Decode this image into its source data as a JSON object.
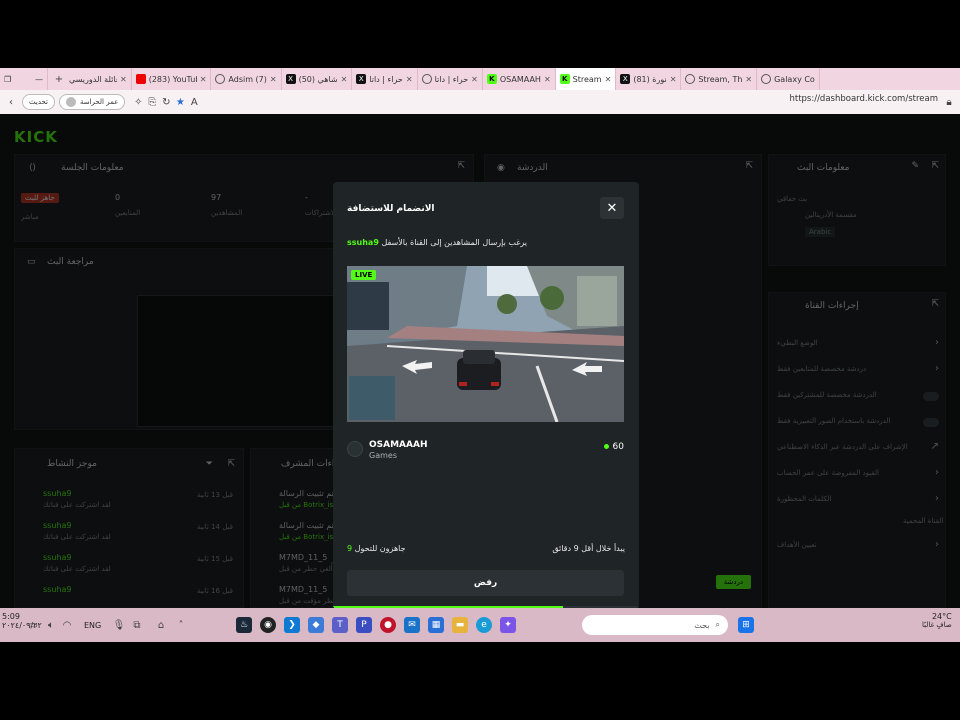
{
  "browser": {
    "tabs": [
      {
        "label": "عائلة الدوريسي",
        "icon": "plus-icon"
      },
      {
        "label": "(283) YouTube",
        "icon": "youtube-icon"
      },
      {
        "label": "Adsim (7)",
        "icon": "globe-icon"
      },
      {
        "label": "شاهي (50)",
        "icon": "x-icon"
      },
      {
        "label": "حراء | داتا",
        "icon": "x-icon"
      },
      {
        "label": "حراء | داتا",
        "icon": "globe-icon"
      },
      {
        "label": "OSAMAAH",
        "icon": "kick-icon"
      },
      {
        "label": "Stream",
        "icon": "kick-icon",
        "active": true
      },
      {
        "label": "نورة (81)",
        "icon": "x-icon"
      },
      {
        "label": "Stream, Th",
        "icon": "globe-icon"
      },
      {
        "label": "Galaxy Co",
        "icon": "globe-icon"
      }
    ],
    "window_controls": {
      "minimize": "—",
      "restore": "❐"
    },
    "address": {
      "url": "https://dashboard.kick.com/stream",
      "update_label": "تحديث",
      "profile_label": "عمر الحراسة"
    }
  },
  "app": {
    "logo": "KICK",
    "session_panel": {
      "title": "معلومات الجلسة",
      "stats": [
        {
          "value": "0",
          "label": "المتابعين"
        },
        {
          "value": "97",
          "label": "المشاهدين"
        },
        {
          "value": "-",
          "label": "الاشتراكات"
        }
      ],
      "badge": "جاهز للبث",
      "status": "مباشر"
    },
    "preview_panel": {
      "title": "مراجعة البث"
    },
    "chat_panel": {
      "title": "الدردشة",
      "send_label": "دردشة",
      "counter_a": "0",
      "counter_b": "0"
    },
    "activity_panel": {
      "title": "موجز النشاط",
      "items": [
        {
          "user": "ssuha9",
          "text": "لقد اشتركت على قناتك",
          "time": "قبل 13 ثانية"
        },
        {
          "user": "ssuha9",
          "text": "لقد اشتركت على قناتك",
          "time": "قبل 14 ثانية"
        },
        {
          "user": "ssuha9",
          "text": "لقد اشتركت على قناتك",
          "time": "قبل 15 ثانية"
        },
        {
          "user": "ssuha9",
          "text": "لقد اشتركت على قناتك",
          "time": "قبل 16 ثانية"
        }
      ]
    },
    "mod_panel": {
      "title": "إجراءات المشرف",
      "items": [
        {
          "title": "تم تثبيت الرسالة",
          "sub": "من قبل Botrix_is"
        },
        {
          "title": "تم تثبيت الرسالة",
          "sub": "من قبل Botrix_is"
        },
        {
          "title": "M7MD_11_5",
          "sub": "أُلغي حظر من قبل"
        },
        {
          "title": "M7MD_11_5",
          "sub": "حظر مؤقت من قبل"
        }
      ]
    },
    "stream_info": {
      "title": "معلومات البث",
      "stream_label": "بث خفاقي",
      "stream_title": "مقسمة الأدرينالين",
      "language": "Arabic"
    },
    "channel_actions": {
      "title": "إجراءات القناة",
      "items": [
        "الوضع البطيء",
        "دردشة مخصصة للمتابعين فقط",
        "الدردشة مخصصة للمشتركين فقط",
        "الدردشة باستخدام الصور التعبيرية فقط",
        "الإشراف على الدردشة عبر الذكاء الاصطناعي",
        "القيود المفروضة على عمر الحساب",
        "الكلمات المحظورة"
      ],
      "section_label": "القناة المحمية",
      "last_item": "تعيين الأهداف"
    }
  },
  "raid_modal": {
    "title": "الانضمام للاستضافة",
    "message_prefix": "يرغب بإرسال المشاهدين إلى القناة بالأسفل",
    "raider": "ssuha9",
    "live_badge": "LIVE",
    "channel_name": "OSAMAAAH",
    "category": "Games",
    "viewer_count": "60",
    "ready_label": "جاهزون للتحول",
    "ready_count": "9",
    "eta_label": "يبدأ خلال أقل 9 دقائق",
    "reject_label": "رفض",
    "progress": 0.75
  },
  "taskbar": {
    "time": "5:09",
    "date": "٢٠٢٤/٠٩/٢٢",
    "language": "ENG",
    "search_placeholder": "بحث",
    "weather": "24°C",
    "weather_desc": "صافٍ غالبًا"
  },
  "colors": {
    "accent": "#53fc18",
    "panel": "#1b2022",
    "modal": "#1f2426"
  }
}
